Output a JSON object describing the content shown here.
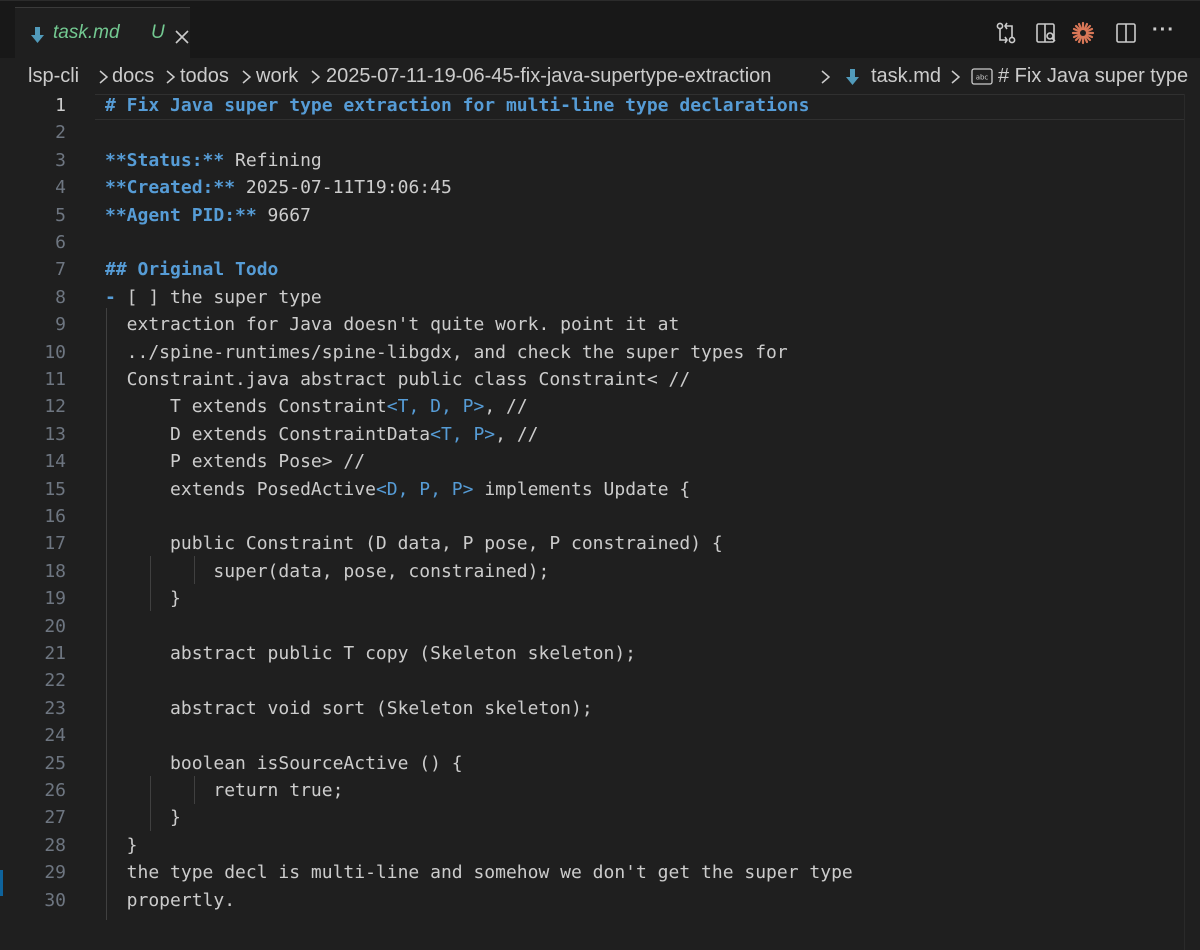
{
  "tab": {
    "label": "task.md",
    "modified": "U"
  },
  "breadcrumb": {
    "items": [
      "lsp-cli",
      "docs",
      "todos",
      "work",
      "2025-07-11-19-06-45-fix-java-supertype-extraction",
      "task.md",
      "# Fix Java super type"
    ]
  },
  "toolbar": {
    "icons": [
      "compare-changes-icon",
      "open-preview-icon",
      "claude-icon",
      "split-editor-icon",
      "more-actions-icon"
    ],
    "more_label": "···"
  },
  "editor": {
    "active_line": 1,
    "lines": [
      {
        "n": "1",
        "parts": [
          {
            "t": "# Fix Java super type extraction for multi-line type declarations",
            "c": "h"
          }
        ]
      },
      {
        "n": "2",
        "parts": []
      },
      {
        "n": "3",
        "parts": [
          {
            "t": "**Status:**",
            "c": "b"
          },
          {
            "t": " Refining",
            "c": ""
          }
        ]
      },
      {
        "n": "4",
        "parts": [
          {
            "t": "**Created:**",
            "c": "b"
          },
          {
            "t": " 2025-07-11T19:06:45",
            "c": ""
          }
        ]
      },
      {
        "n": "5",
        "parts": [
          {
            "t": "**Agent PID:**",
            "c": "b"
          },
          {
            "t": " 9667",
            "c": ""
          }
        ]
      },
      {
        "n": "6",
        "parts": []
      },
      {
        "n": "7",
        "parts": [
          {
            "t": "## Original Todo",
            "c": "h"
          }
        ]
      },
      {
        "n": "8",
        "parts": [
          {
            "t": "-",
            "c": "b"
          },
          {
            "t": " [ ] the super type",
            "c": ""
          }
        ]
      },
      {
        "n": "9",
        "parts": [
          {
            "t": "  extraction for Java doesn't quite work. point it at",
            "c": ""
          }
        ]
      },
      {
        "n": "10",
        "parts": [
          {
            "t": "  ../spine-runtimes/spine-libgdx, and check the super types for",
            "c": ""
          }
        ]
      },
      {
        "n": "11",
        "parts": [
          {
            "t": "  Constraint.java abstract public class Constraint< //",
            "c": ""
          }
        ]
      },
      {
        "n": "12",
        "parts": [
          {
            "t": "      T extends Constraint",
            "c": ""
          },
          {
            "t": "<T, D, P>",
            "c": "tp"
          },
          {
            "t": ", //",
            "c": ""
          }
        ]
      },
      {
        "n": "13",
        "parts": [
          {
            "t": "      D extends ConstraintData",
            "c": ""
          },
          {
            "t": "<T, P>",
            "c": "tp"
          },
          {
            "t": ", //",
            "c": ""
          }
        ]
      },
      {
        "n": "14",
        "parts": [
          {
            "t": "      P extends Pose> //",
            "c": ""
          }
        ]
      },
      {
        "n": "15",
        "parts": [
          {
            "t": "      extends PosedActive",
            "c": ""
          },
          {
            "t": "<D, P, P>",
            "c": "tp"
          },
          {
            "t": " implements Update {",
            "c": ""
          }
        ]
      },
      {
        "n": "16",
        "parts": []
      },
      {
        "n": "17",
        "parts": [
          {
            "t": "      public Constraint (D data, P pose, P constrained) {",
            "c": ""
          }
        ]
      },
      {
        "n": "18",
        "parts": [
          {
            "t": "          super(data, pose, constrained);",
            "c": ""
          }
        ]
      },
      {
        "n": "19",
        "parts": [
          {
            "t": "      }",
            "c": ""
          }
        ]
      },
      {
        "n": "20",
        "parts": []
      },
      {
        "n": "21",
        "parts": [
          {
            "t": "      abstract public T copy (Skeleton skeleton);",
            "c": ""
          }
        ]
      },
      {
        "n": "22",
        "parts": []
      },
      {
        "n": "23",
        "parts": [
          {
            "t": "      abstract void sort (Skeleton skeleton);",
            "c": ""
          }
        ]
      },
      {
        "n": "24",
        "parts": []
      },
      {
        "n": "25",
        "parts": [
          {
            "t": "      boolean isSourceActive () {",
            "c": ""
          }
        ]
      },
      {
        "n": "26",
        "parts": [
          {
            "t": "          return true;",
            "c": ""
          }
        ]
      },
      {
        "n": "27",
        "parts": [
          {
            "t": "      }",
            "c": ""
          }
        ]
      },
      {
        "n": "28",
        "parts": [
          {
            "t": "  }",
            "c": ""
          }
        ]
      },
      {
        "n": "29",
        "parts": [
          {
            "t": "  the type decl is multi-line and somehow we don't get the super type",
            "c": ""
          }
        ]
      },
      {
        "n": "30",
        "parts": [
          {
            "t": "  propertly.",
            "c": ""
          }
        ]
      }
    ]
  },
  "colors": {
    "background": "#1f1f1f",
    "heading": "#569cd6",
    "text": "#cccccc",
    "modified": "#73c991",
    "line_number": "#6e7681",
    "claude_accent": "#d97757"
  }
}
